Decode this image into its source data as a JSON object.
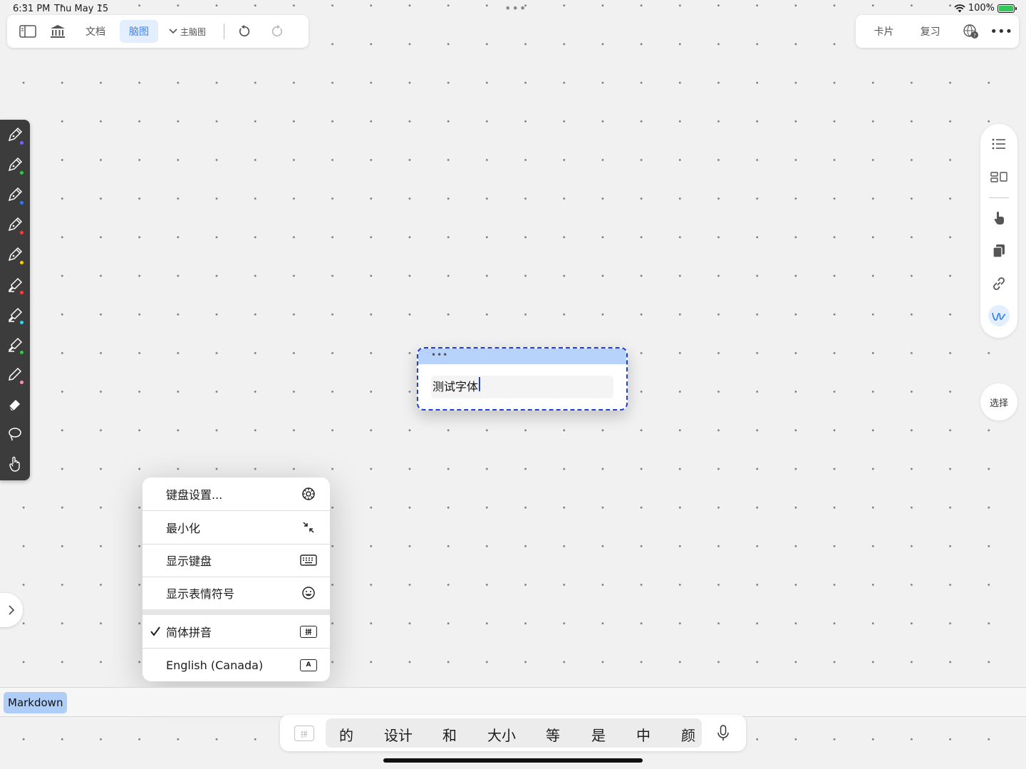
{
  "status": {
    "time": "6:31 PM",
    "date": "Thu May 15",
    "battery": "100%"
  },
  "toolbar_left": {
    "doc_tab": "文档",
    "mindmap_tab": "脑图",
    "theme_dropdown": "主脑图"
  },
  "toolbar_right": {
    "cards": "卡片",
    "review": "复习"
  },
  "right_bar": {
    "select_label": "选择"
  },
  "node": {
    "text": "测试字体"
  },
  "menu": {
    "items": [
      {
        "label": "键盘设置...",
        "icon": "gear-icon"
      },
      {
        "label": "最小化",
        "icon": "minimize-arrows-icon"
      },
      {
        "label": "显示键盘",
        "icon": "keyboard-icon"
      },
      {
        "label": "显示表情符号",
        "icon": "emoji-icon"
      }
    ],
    "input_methods": [
      {
        "label": "简体拼音",
        "checked": true,
        "badge": "拼"
      },
      {
        "label": "English (Canada)",
        "checked": false,
        "badge": "A"
      }
    ]
  },
  "markdown_label": "Markdown",
  "candidates": [
    "的",
    "设计",
    "和",
    "大小",
    "等",
    "是",
    "中",
    "颜"
  ],
  "candidate_key": "拼",
  "colors": {
    "accent": "#3b82f6",
    "node_border": "#1d3fe0",
    "node_header": "#b7d3fb",
    "pen_bar": "#3c3c3c"
  }
}
